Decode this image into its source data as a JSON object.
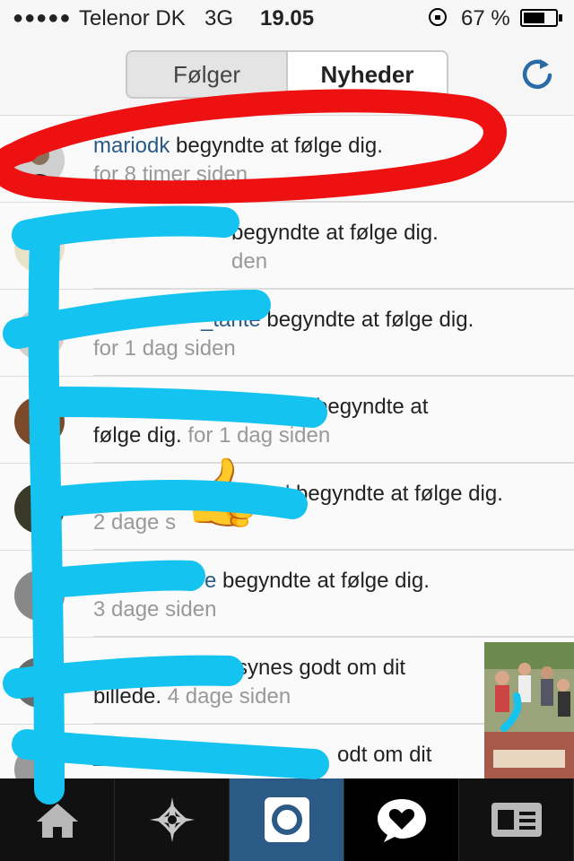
{
  "status_bar": {
    "signal_dots": "●●●●●",
    "carrier": "Telenor DK",
    "network": "3G",
    "time": "19.05",
    "battery_percent": "67 %",
    "battery_level": 0.67
  },
  "header": {
    "tabs": [
      {
        "label": "Følger",
        "selected": false
      },
      {
        "label": "Nyheder",
        "selected": true
      }
    ],
    "refresh_icon": "refresh-icon"
  },
  "activity": [
    {
      "user": "mariodk",
      "action": "begyndte at følge dig.",
      "time": "for 8 timer siden"
    },
    {
      "user": "",
      "action": "begyndte at følge dig.",
      "time": "den"
    },
    {
      "user": "_tante",
      "action": "begyndte at følge dig.",
      "time": "for 1 dag siden"
    },
    {
      "user": "",
      "action": "begyndte at følge dig.",
      "time": "for 1 dag siden"
    },
    {
      "user": "d",
      "action": "begyndte at følge dig.",
      "time": "2 dage s"
    },
    {
      "user": "e",
      "action": "begyndte at følge dig.",
      "time": "3 dage siden"
    },
    {
      "user": "",
      "action": "synes godt om dit billede.",
      "time": "4 dage siden"
    },
    {
      "user": "_hi",
      "action": "odt om dit",
      "time": ""
    }
  ],
  "tab_bar": [
    {
      "icon": "home-icon"
    },
    {
      "icon": "explore-star-icon"
    },
    {
      "icon": "camera-icon"
    },
    {
      "icon": "news-heart-icon"
    },
    {
      "icon": "profile-card-icon"
    }
  ],
  "emoji": "👍",
  "colors": {
    "username": "#2a5a87",
    "active_tab": "#2b5a86",
    "red_scribble": "#ee1111",
    "blue_scribble": "#14c3ef"
  }
}
